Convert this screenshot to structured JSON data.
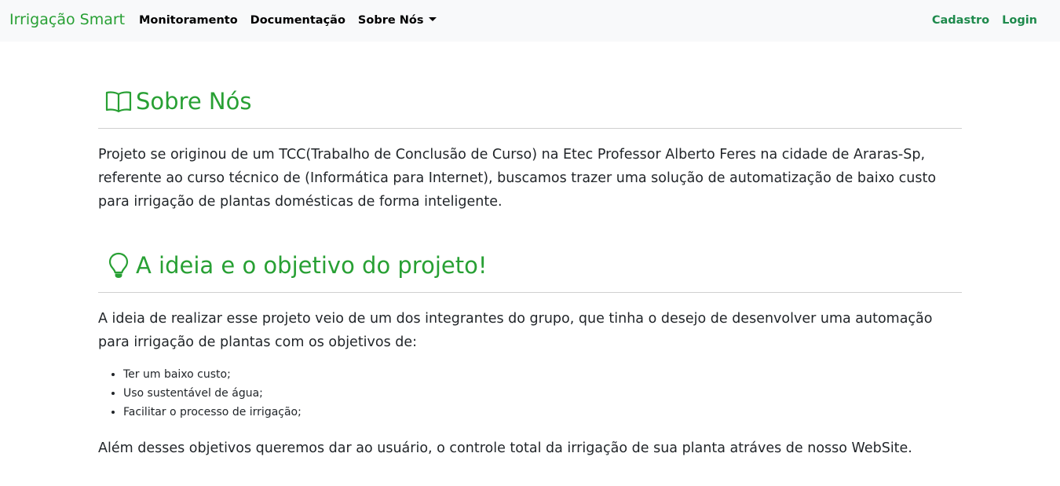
{
  "navbar": {
    "brand": "Irrigação Smart",
    "links": {
      "monitoramento": "Monitoramento",
      "documentacao": "Documentação",
      "sobre_nos": "Sobre Nós"
    },
    "right_links": {
      "cadastro": "Cadastro",
      "login": "Login"
    }
  },
  "sections": {
    "about": {
      "icon": "book-icon",
      "title": "Sobre Nós",
      "text": "Projeto se originou de um TCC(Trabalho de Conclusão de Curso) na Etec Professor Alberto Feres na cidade de Araras-Sp, referente ao curso técnico de (Informática para Internet), buscamos trazer uma solução de automatização de baixo custo para irrigação de plantas domésticas de forma inteligente."
    },
    "idea": {
      "icon": "lightbulb-icon",
      "title": "A ideia e o objetivo do projeto!",
      "intro": "A ideia de realizar esse projeto veio de um dos integrantes do grupo, que tinha o desejo de desenvolver uma automação para irrigação de plantas com os objetivos de:",
      "goals": [
        "Ter um baixo custo;",
        "Uso sustentável de água;",
        "Facilitar o processo de irrigação;"
      ],
      "closing": "Além desses objetivos queremos dar ao usuário, o controle total da irrigação de sua planta atráves de nosso WebSite."
    }
  },
  "colors": {
    "accent": "#28a034",
    "nav_right": "#1e8a4c",
    "navbar_bg": "#f8f9fa"
  }
}
